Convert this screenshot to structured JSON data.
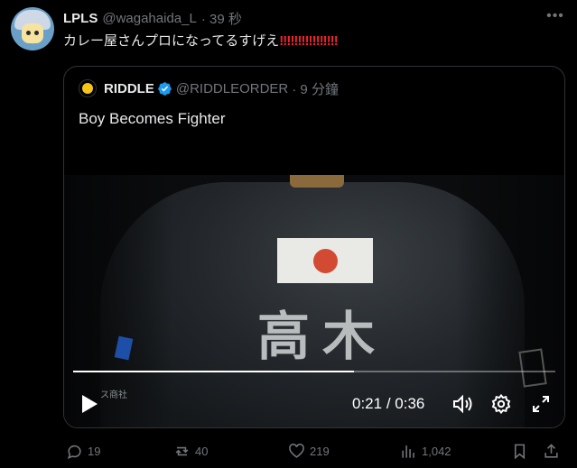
{
  "author": {
    "name": "LPLS",
    "handle": "@wagahaida_L",
    "time": "· 39 秒",
    "more_icon": "more-dots-icon"
  },
  "post": {
    "text": "カレー屋さんプロになってるすげえ",
    "emphasis": "‼‼‼‼‼‼‼‼"
  },
  "quote": {
    "name": "RIDDLE",
    "handle": "@RIDDLEORDER",
    "time": "· 9 分鐘",
    "text": "Boy Becomes Fighter",
    "video": {
      "shirt_text": "高木",
      "small_text": "ス商社",
      "current_time": "0:21",
      "separator": "/",
      "duration": "0:36",
      "progress": 0.5833
    }
  },
  "actions": {
    "reply_count": "19",
    "repost_count": "40",
    "like_count": "219",
    "view_count": "1,042"
  },
  "colors": {
    "background": "#000000",
    "text": "#e7e9ea",
    "muted": "#71767b",
    "verified": "#1d9bf0",
    "emphasis": "#f4212e"
  }
}
